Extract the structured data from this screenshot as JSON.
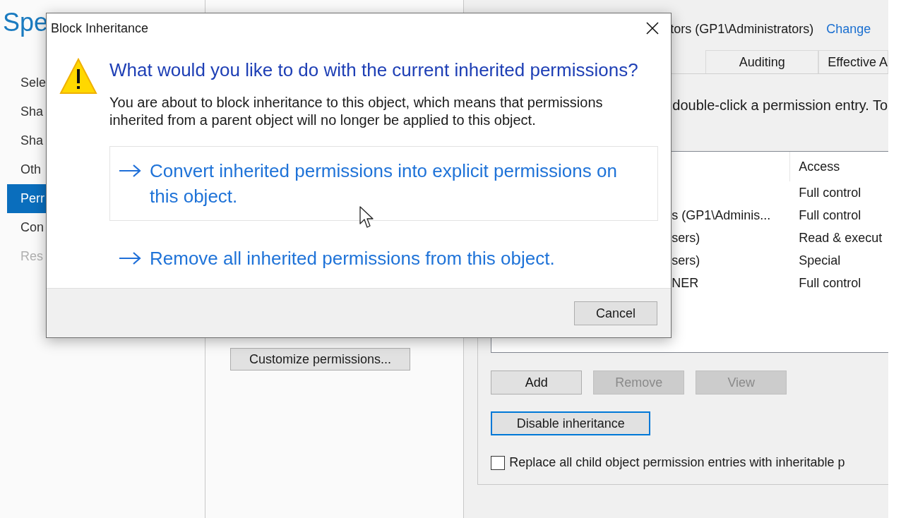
{
  "page_heading": "Spe",
  "sidebar": {
    "items": [
      {
        "label": "Sele",
        "selected": false,
        "disabled": false
      },
      {
        "label": "Sha",
        "selected": false,
        "disabled": false
      },
      {
        "label": "Sha",
        "selected": false,
        "disabled": false
      },
      {
        "label": "Oth",
        "selected": false,
        "disabled": false
      },
      {
        "label": "Perr",
        "selected": true,
        "disabled": false
      },
      {
        "label": "Con",
        "selected": false,
        "disabled": false
      },
      {
        "label": "Res",
        "selected": false,
        "disabled": true
      }
    ]
  },
  "customize_button": "Customize permissions...",
  "permissions_panel": {
    "owner_text": "tors (GP1\\Administrators)",
    "owner_link": "Change",
    "tabs": [
      {
        "label": "Auditing",
        "selected": false
      },
      {
        "label": "Effective A",
        "selected": false
      }
    ],
    "instructions": "double-click a permission entry. To",
    "table": {
      "columns": [
        "Access"
      ],
      "rows": [
        {
          "access": "Full control"
        },
        {
          "principal": "s (GP1\\Adminis...",
          "access": "Full control"
        },
        {
          "principal": "sers)",
          "access": "Read & execut"
        },
        {
          "principal": "sers)",
          "access": "Special"
        },
        {
          "principal": "NER",
          "access": "Full control"
        }
      ]
    },
    "buttons": [
      {
        "label": "Add",
        "disabled": false
      },
      {
        "label": "Remove",
        "disabled": true
      },
      {
        "label": "View",
        "disabled": true
      }
    ],
    "inheritance_button": {
      "label": "Disable inheritance",
      "focused": true
    },
    "replace_checkbox": {
      "label": "Replace all child object permission entries with inheritable p",
      "checked": false
    }
  },
  "dialog": {
    "title": "Block Inheritance",
    "heading": "What would you like to do with the current inherited permissions?",
    "message": "You are about to block inheritance to this object, which means that permissions inherited from a parent object will no longer be applied to this object.",
    "options": [
      {
        "label": "Convert inherited permissions into explicit permissions on this object.",
        "hovered": true
      },
      {
        "label": "Remove all inherited permissions from this object.",
        "hovered": false
      }
    ],
    "cancel_button": "Cancel"
  }
}
